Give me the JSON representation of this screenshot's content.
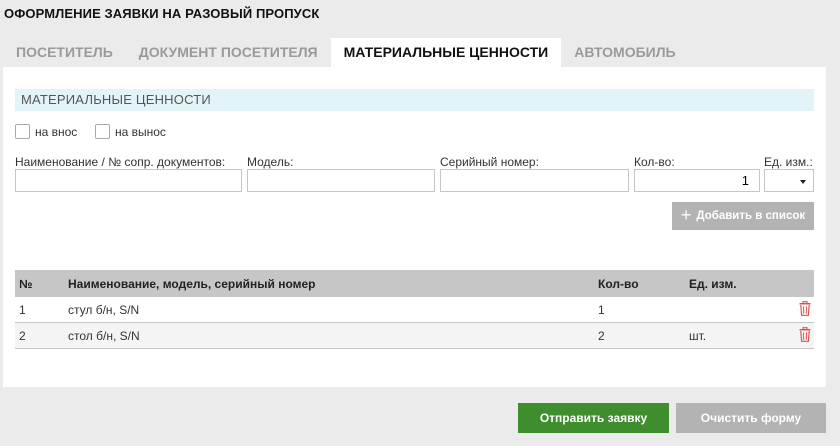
{
  "page": {
    "title": "ОФОРМЛЕНИЕ ЗАЯВКИ НА РАЗОВЫЙ ПРОПУСК"
  },
  "tabs": [
    {
      "label": "ПОСЕТИТЕЛЬ",
      "active": false
    },
    {
      "label": "ДОКУМЕНТ ПОСЕТИТЕЛЯ",
      "active": false
    },
    {
      "label": "МАТЕРИАЛЬНЫЕ ЦЕННОСТИ",
      "active": true
    },
    {
      "label": "АВТОМОБИЛЬ",
      "active": false
    }
  ],
  "section": {
    "title": "МАТЕРИАЛЬНЫЕ ЦЕННОСТИ"
  },
  "checkboxes": {
    "bring_in": {
      "label": "на внос",
      "checked": false
    },
    "take_out": {
      "label": "на вынос",
      "checked": false
    }
  },
  "form": {
    "name": {
      "label": "Наименование / № сопр. документов:",
      "value": ""
    },
    "model": {
      "label": "Модель:",
      "value": ""
    },
    "serial": {
      "label": "Серийный номер:",
      "value": ""
    },
    "qty": {
      "label": "Кол-во:",
      "value": "1"
    },
    "unit": {
      "label": "Ед. изм.:",
      "value": ""
    },
    "add_button": "Добавить в список"
  },
  "table": {
    "headers": {
      "num": "№",
      "name": "Наименование, модель, серийный номер",
      "qty": "Кол-во",
      "unit": "Ед. изм."
    },
    "rows": [
      {
        "num": "1",
        "name": "стул б/н, S/N",
        "qty": "1",
        "unit": ""
      },
      {
        "num": "2",
        "name": "стол б/н, S/N",
        "qty": "2",
        "unit": "шт."
      }
    ]
  },
  "actions": {
    "submit": "Отправить заявку",
    "clear": "Очистить форму"
  },
  "colors": {
    "submit": "#3f8e2e",
    "secondary": "#b3b3b3",
    "section_header_bg": "#e3f4f9",
    "delete_icon": "#d9534f"
  },
  "icons": {
    "add": "plus-icon",
    "delete": "trash-icon",
    "dropdown": "chevron-down-icon"
  }
}
